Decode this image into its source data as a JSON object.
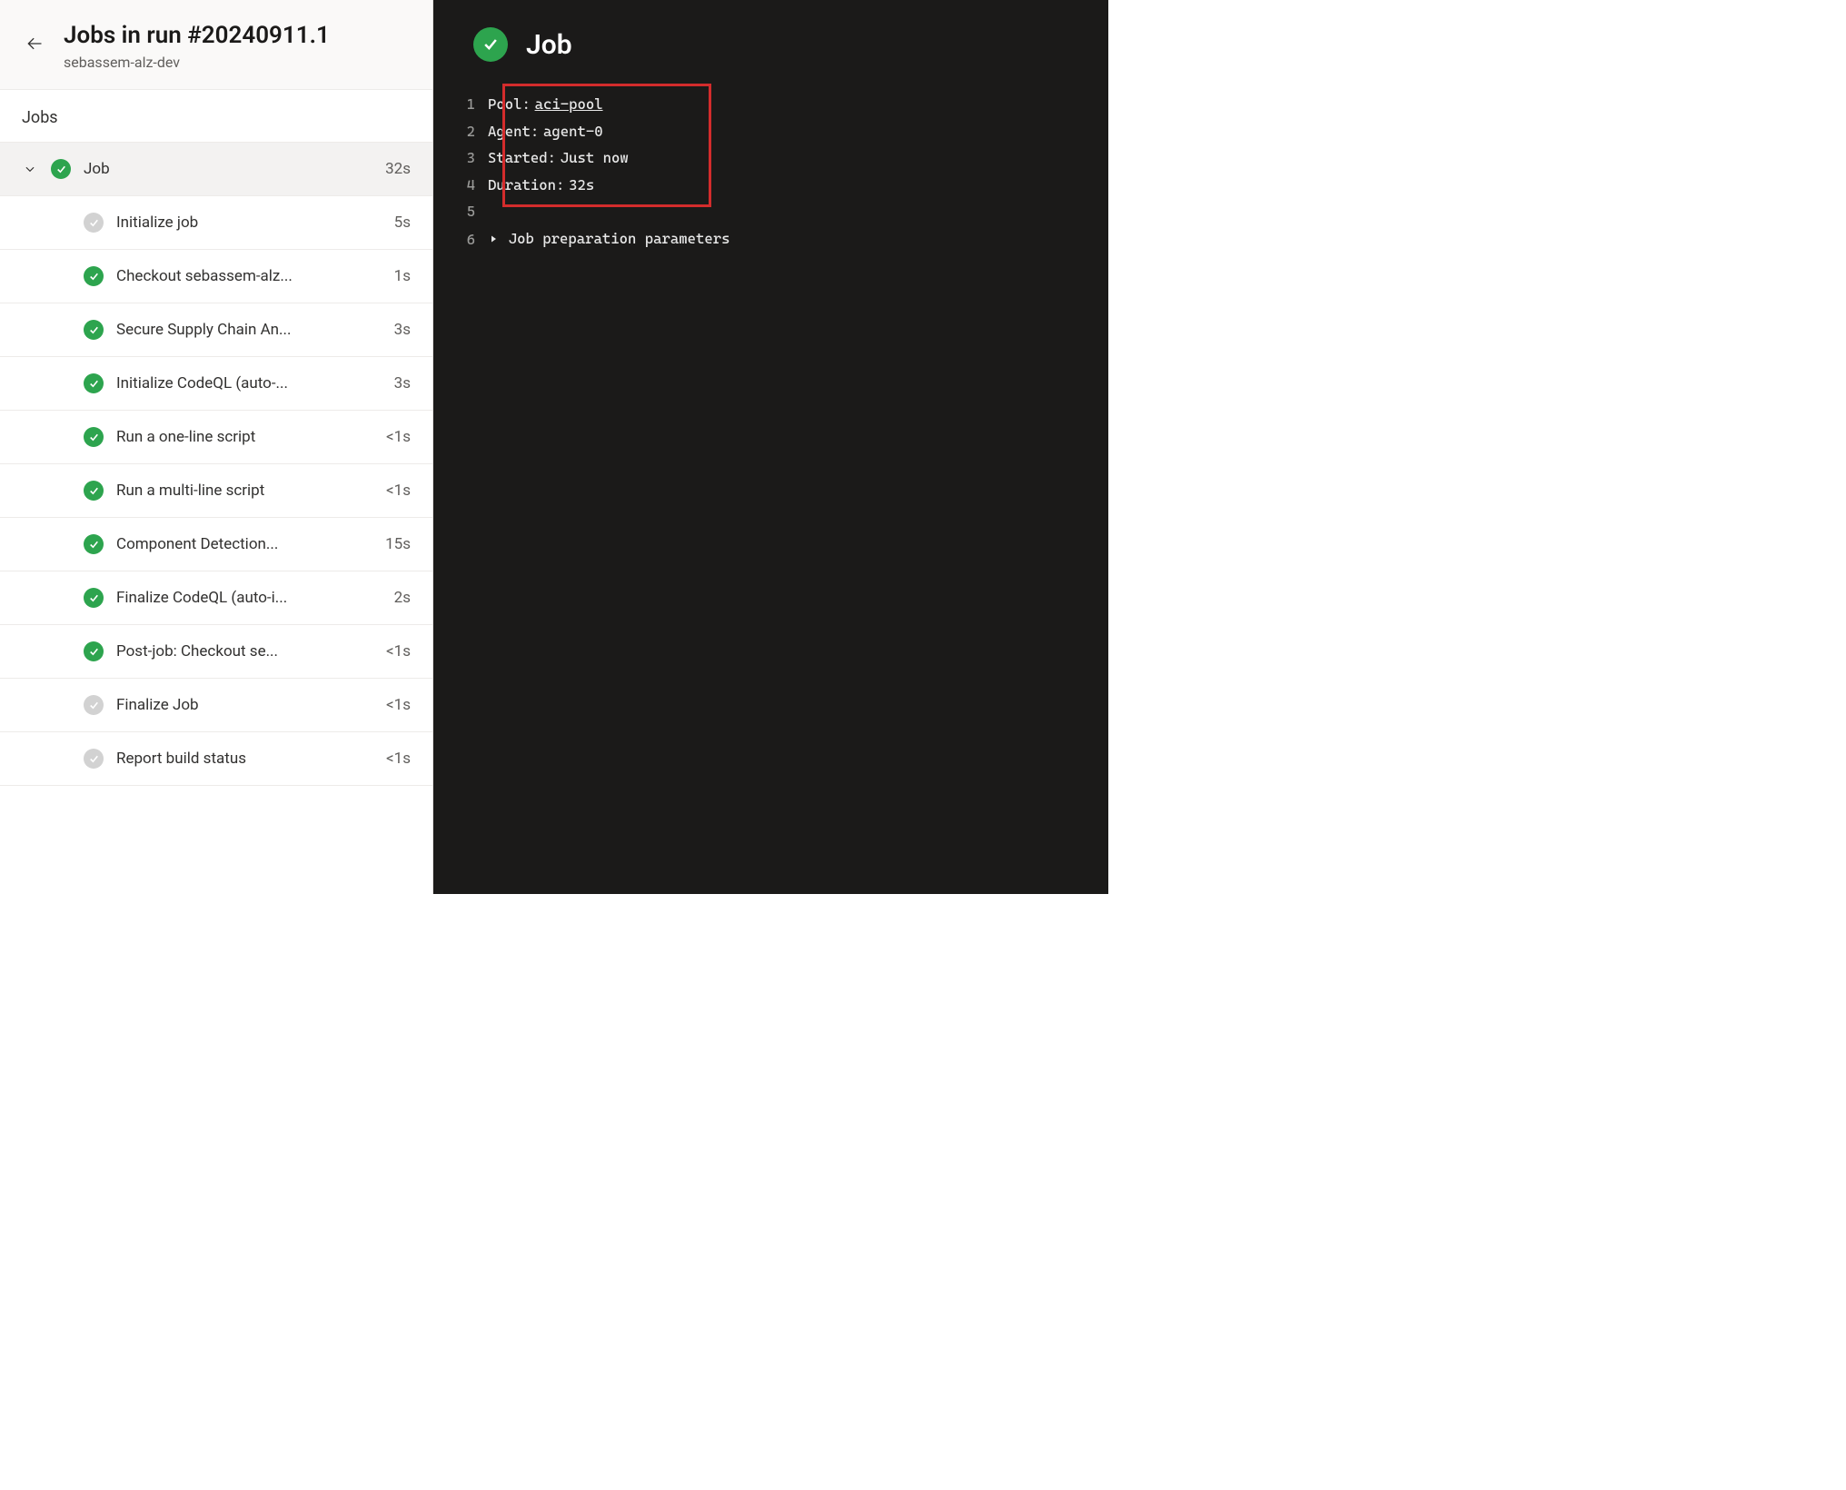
{
  "header": {
    "title": "Jobs in run #20240911.1",
    "subtitle": "sebassem-alz-dev"
  },
  "section_label": "Jobs",
  "job": {
    "name": "Job",
    "duration": "32s",
    "steps": [
      {
        "name": "Initialize job",
        "status": "neutral",
        "duration": "5s"
      },
      {
        "name": "Checkout sebassem-alz...",
        "status": "success",
        "duration": "1s"
      },
      {
        "name": "Secure Supply Chain An...",
        "status": "success",
        "duration": "3s"
      },
      {
        "name": "Initialize CodeQL (auto-...",
        "status": "success",
        "duration": "3s"
      },
      {
        "name": "Run a one-line script",
        "status": "success",
        "duration": "<1s"
      },
      {
        "name": "Run a multi-line script",
        "status": "success",
        "duration": "<1s"
      },
      {
        "name": "Component Detection...",
        "status": "success",
        "duration": "15s"
      },
      {
        "name": "Finalize CodeQL (auto-i...",
        "status": "success",
        "duration": "2s"
      },
      {
        "name": "Post-job: Checkout se...",
        "status": "success",
        "duration": "<1s"
      },
      {
        "name": "Finalize Job",
        "status": "neutral",
        "duration": "<1s"
      },
      {
        "name": "Report build status",
        "status": "neutral",
        "duration": "<1s"
      }
    ]
  },
  "log": {
    "title": "Job",
    "lines": [
      {
        "n": 1,
        "label": "Pool:",
        "value": "aci-pool",
        "link": true
      },
      {
        "n": 2,
        "label": "Agent:",
        "value": "agent-0"
      },
      {
        "n": 3,
        "label": "Started:",
        "value": "Just now"
      },
      {
        "n": 4,
        "label": "Duration:",
        "value": "32s"
      },
      {
        "n": 5,
        "label": "",
        "value": ""
      },
      {
        "n": 6,
        "label": "",
        "value": "Job preparation parameters",
        "fold": true
      }
    ]
  }
}
